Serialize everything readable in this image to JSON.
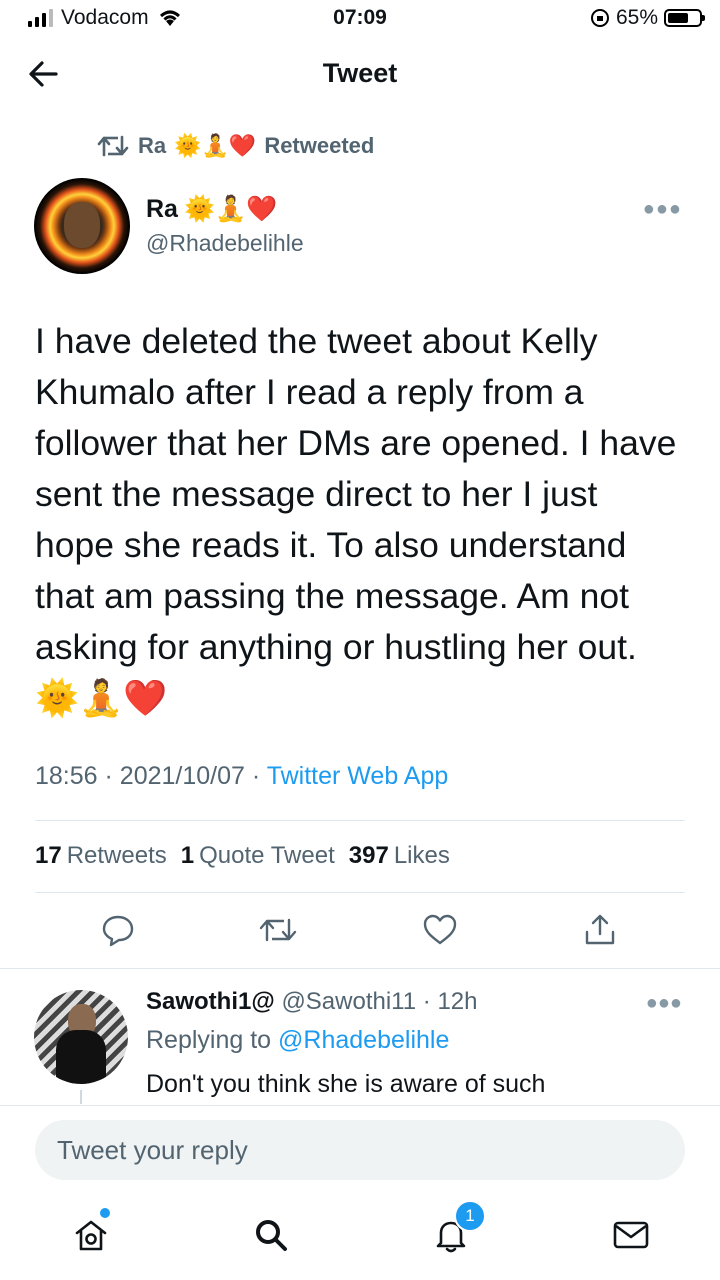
{
  "status_bar": {
    "carrier": "Vodacom",
    "time": "07:09",
    "battery": "65%",
    "battery_level": 0.65
  },
  "header": {
    "title": "Tweet"
  },
  "retweet": {
    "name": "Ra",
    "emojis": "🌞🧘❤️",
    "label": "Retweeted"
  },
  "tweet": {
    "author_name": "Ra",
    "author_emojis": "🌞🧘❤️",
    "handle": "@Rhadebelihle",
    "text": "I have deleted the tweet about Kelly Khumalo after I read a reply from a follower that her DMs are opened. I have sent the message direct to her I just hope she reads it. To also understand that am passing the message. Am not asking for anything or hustling her out. 🌞🧘❤️",
    "time": "18:56",
    "date": "2021/10/07",
    "source": "Twitter Web App",
    "retweets_count": "17",
    "retweets_label": "Retweets",
    "quotes_count": "1",
    "quotes_label": "Quote Tweet",
    "likes_count": "397",
    "likes_label": "Likes"
  },
  "reply": {
    "name": "Sawothi1@",
    "handle": "@Sawothi11",
    "age": "12h",
    "replying_label": "Replying to",
    "replying_to": "@Rhadebelihle",
    "text": "Don't you think she is aware of such"
  },
  "composer": {
    "placeholder": "Tweet your reply"
  },
  "tabbar": {
    "notifications_badge": "1"
  },
  "colors": {
    "accent": "#1d9bf0",
    "muted": "#536471",
    "text": "#0f1419"
  }
}
